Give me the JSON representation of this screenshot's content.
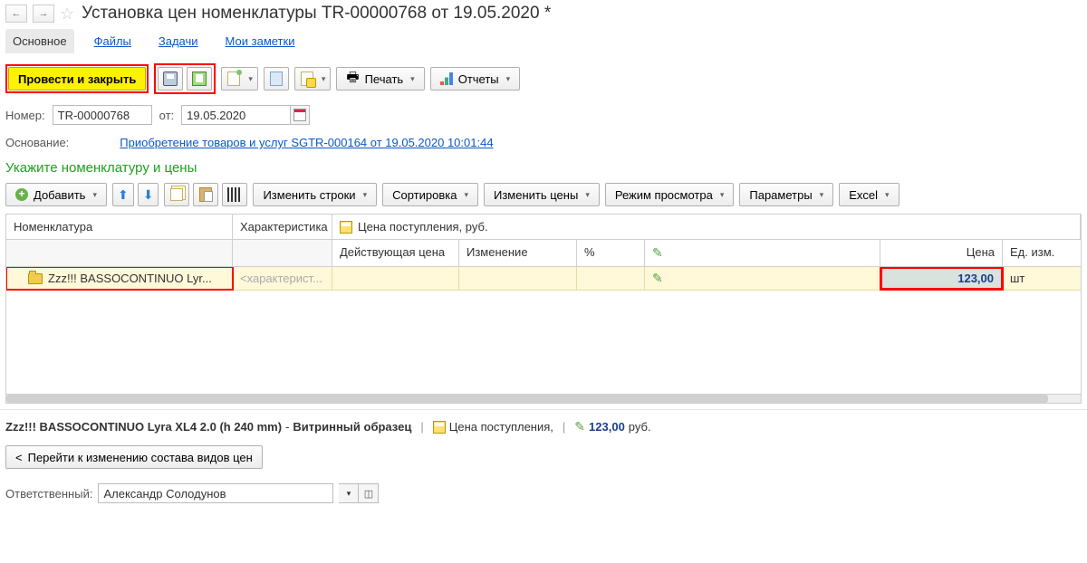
{
  "header": {
    "title": "Установка цен номенклатуры TR-00000768 от 19.05.2020 *"
  },
  "tabs": {
    "main": "Основное",
    "files": "Файлы",
    "tasks": "Задачи",
    "notes": "Мои заметки"
  },
  "toolbar": {
    "post_close": "Провести и закрыть",
    "print": "Печать",
    "reports": "Отчеты"
  },
  "fields": {
    "number_label": "Номер:",
    "number_value": "TR-00000768",
    "date_label": "от:",
    "date_value": "19.05.2020",
    "basis_label": "Основание:",
    "basis_link": "Приобретение товаров и услуг SGTR-000164 от 19.05.2020 10:01:44"
  },
  "section_title": "Укажите номенклатуру и цены",
  "table_toolbar": {
    "add": "Добавить",
    "change_rows": "Изменить строки",
    "sort": "Сортировка",
    "change_prices": "Изменить цены",
    "view_mode": "Режим просмотра",
    "params": "Параметры",
    "excel": "Excel"
  },
  "grid": {
    "columns": {
      "nomenclature": "Номенклатура",
      "characteristic": "Характеристика",
      "price_group": "Цена поступления, руб.",
      "current_price": "Действующая цена",
      "change": "Изменение",
      "percent": "%",
      "price": "Цена",
      "unit": "Ед. изм."
    },
    "rows": [
      {
        "nomenclature": "Zzz!!! BASSOCONTINUO Lyr...",
        "characteristic_placeholder": "<характерист...",
        "price": "123,00",
        "unit": "шт"
      }
    ]
  },
  "footer": {
    "product_name": "Zzz!!! BASSOCONTINUO Lyra XL4 2.0 (h 240 mm)",
    "sample": "Витринный образец",
    "price_label": "Цена поступления,",
    "price_value": "123,00",
    "currency": "руб."
  },
  "bottom": {
    "goto_price_types": "Перейти к изменению состава видов цен"
  },
  "responsible": {
    "label": "Ответственный:",
    "value": "Александр Солодунов"
  }
}
